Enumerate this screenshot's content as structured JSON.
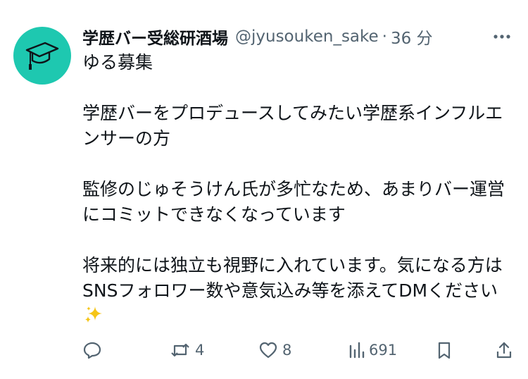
{
  "tweet": {
    "author": {
      "display_name": "学歴バー受総研酒場",
      "handle": "@jyusouken_sake",
      "avatar_icon": "graduation-cap-icon",
      "avatar_color": "#1ec8b0"
    },
    "separator": "·",
    "time": "36 分",
    "body": {
      "line1": "ゆる募集",
      "para1": "学歴バーをプロデュースしてみたい学歴系インフルエンサーの方",
      "para2": "監修のじゅそうけん氏が多忙なため、あまりバー運営にコミットできなくなっています",
      "para3": "将来的には独立も視野に入れています。気になる方はSNSフォロワー数や意気込み等を添えてDMください"
    },
    "actions": {
      "reply": {
        "icon": "reply-icon",
        "count": ""
      },
      "retweet": {
        "icon": "retweet-icon",
        "count": "4"
      },
      "like": {
        "icon": "heart-icon",
        "count": "8"
      },
      "views": {
        "icon": "views-chart-icon",
        "count": "691"
      },
      "bookmark": {
        "icon": "bookmark-icon"
      },
      "share": {
        "icon": "share-icon"
      }
    },
    "colors": {
      "text": "#0f1419",
      "secondary": "#536471",
      "sparkle": "#f5c518"
    }
  }
}
